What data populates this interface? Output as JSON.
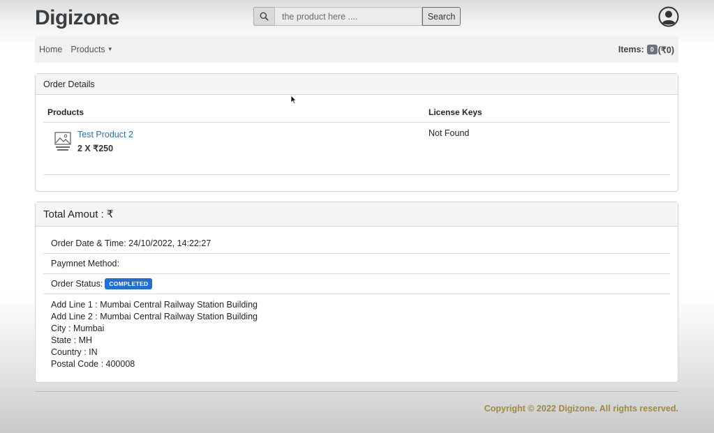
{
  "header": {
    "brand": "Digizone",
    "search": {
      "placeholder": "the product here ....",
      "button_label": "Search"
    }
  },
  "navbar": {
    "home_label": "Home",
    "products_label": "Products",
    "cart_label": "Items:",
    "cart_count": "0",
    "cart_total": "(₹0)"
  },
  "order_details": {
    "title": "Order Details",
    "col_products": "Products",
    "col_license": "License Keys",
    "products": [
      {
        "name": "Test Product 2",
        "qty_price": "2 X ₹250",
        "license": "Not Found"
      }
    ]
  },
  "summary": {
    "total_label": "Total Amout : ₹",
    "order_date": "Order Date & Time: 24/10/2022, 14:22:27",
    "payment": "Paymnet Method:",
    "status_label": "Order Status:",
    "status_value": "COMPLETED",
    "address": [
      "Add Line 1 : Mumbai Central Railway Station Building",
      "Add Line 2 : Mumbai Central Railway Station Building",
      "City : Mumbai",
      "State : MH",
      "Country : IN",
      "Postal Code : 400008"
    ]
  },
  "footer": {
    "copyright": "Copyright © 2022 Digizone. All rights reserved."
  },
  "colors": {
    "link": "#2a6fb0",
    "status_badge": "#1f6fd6",
    "footer_text": "#a08a3c"
  }
}
